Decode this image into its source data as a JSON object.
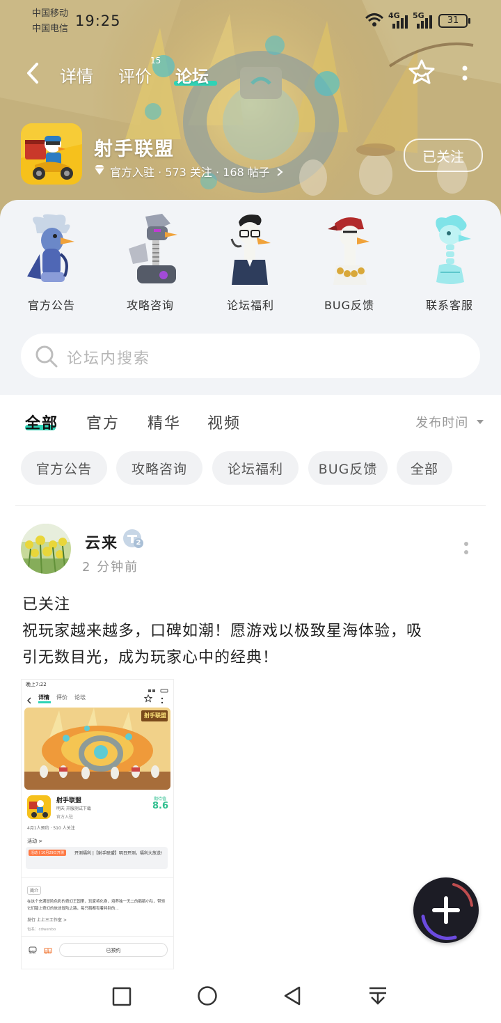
{
  "status_bar": {
    "carrier1": "中国移动",
    "carrier2": "中国电信",
    "time": "19:25",
    "net1": "4G",
    "net2": "5G",
    "battery": "31"
  },
  "nav": {
    "tabs": [
      "详情",
      "评价",
      "论坛"
    ],
    "review_badge": "15",
    "active_tab": "论坛"
  },
  "app": {
    "name": "射手联盟",
    "stats": "官方入驻 · 573 关注 · 168 帖子",
    "follow_button": "已关注"
  },
  "categories": [
    {
      "label": "官方公告",
      "icon": "blue-knight-goose-icon"
    },
    {
      "label": "攻略咨询",
      "icon": "robot-goose-icon"
    },
    {
      "label": "论坛福利",
      "icon": "glasses-goose-icon"
    },
    {
      "label": "BUG反馈",
      "icon": "pirate-goose-icon"
    },
    {
      "label": "联系客服",
      "icon": "ghost-goose-icon"
    }
  ],
  "search": {
    "placeholder": "论坛内搜索"
  },
  "filter_tabs": [
    "全部",
    "官方",
    "精华",
    "视频"
  ],
  "sort_label": "发布时间",
  "chips": [
    "官方公告",
    "攻略咨询",
    "论坛福利",
    "BUG反馈",
    "全部"
  ],
  "post": {
    "user": "云来",
    "level": "2",
    "time": "2 分钟前",
    "text_line1": "已关注",
    "text_line2": "祝玩家越来越多，口碑如潮！愿游戏以极致星海体验，吸",
    "text_line3": "引无数目光，成为玩家心中的经典！",
    "screenshot": {
      "time": "晚上7:22",
      "tabs": [
        "详情",
        "评价",
        "论坛"
      ],
      "banner_logo": "射手联盟",
      "app_name": "射手联盟",
      "subtitle": "明天 开服测试下载",
      "official": "官方入驻",
      "rating_label": "期待值",
      "rating": "8.6",
      "stats": "4月1人预约 · 510 人关注",
      "activity": "活动 >",
      "event_tag": "活动丨10月29日开测",
      "event_text": "开测福利 |【射手联盟】明日开测，福利大放送!",
      "intro_tag": "简介",
      "intro": "在这个充满冒险色彩的奇幻王国里，玩家将化身，培养独一无二的鹅鹅小队，带领它们踏上奇幻的旅途冒险之路，每只鹅都有着特别的...",
      "dev": "发行  上上三工作室 >",
      "pkg": "包名：cdwenbo",
      "reserve_btn": "已预约",
      "bottom_icons": [
        "论坛",
        "福利"
      ]
    }
  },
  "colors": {
    "accent": "#2fd3b6",
    "panel": "#f2f4f7",
    "chip": "#f1f2f4",
    "fab": "#1c1c25"
  }
}
